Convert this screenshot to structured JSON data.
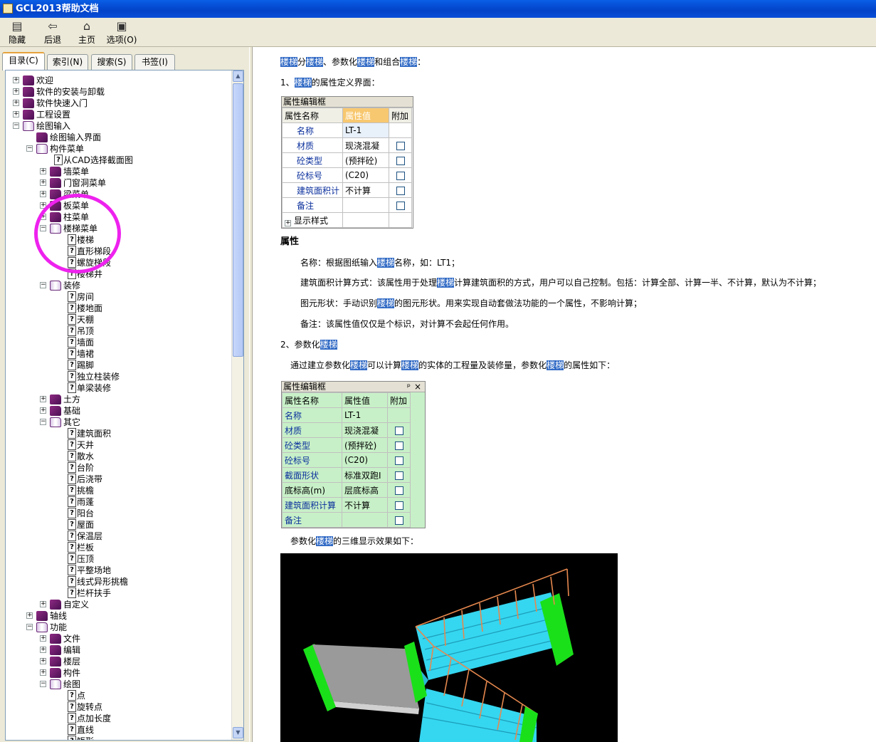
{
  "window": {
    "title": "GCL2013帮助文档"
  },
  "toolbar": {
    "hide": "隐藏",
    "back": "后退",
    "home": "主页",
    "options": "选项(O)"
  },
  "tabs": [
    "目录(C)",
    "索引(N)",
    "搜索(S)",
    "书签(I)"
  ],
  "tree": [
    {
      "label": "欢迎",
      "type": "book",
      "level": 0,
      "expanded": false
    },
    {
      "label": "软件的安装与卸载",
      "type": "book",
      "level": 0,
      "expanded": false
    },
    {
      "label": "软件快速入门",
      "type": "book",
      "level": 0,
      "expanded": false
    },
    {
      "label": "工程设置",
      "type": "book",
      "level": 0,
      "expanded": false
    },
    {
      "label": "绘图输入",
      "type": "book",
      "level": 0,
      "expanded": true
    },
    {
      "label": "绘图输入界面",
      "type": "book",
      "level": 1,
      "expanded": false,
      "noexp": true
    },
    {
      "label": "构件菜单",
      "type": "book",
      "level": 1,
      "expanded": true
    },
    {
      "label": "从CAD选择截面图",
      "type": "page",
      "level": 2
    },
    {
      "label": "墙菜单",
      "type": "book",
      "level": 2,
      "expanded": false
    },
    {
      "label": "门窗洞菜单",
      "type": "book",
      "level": 2,
      "expanded": false
    },
    {
      "label": "梁菜单",
      "type": "book",
      "level": 2,
      "expanded": false
    },
    {
      "label": "板菜单",
      "type": "book",
      "level": 2,
      "expanded": false
    },
    {
      "label": "柱菜单",
      "type": "book",
      "level": 2,
      "expanded": false
    },
    {
      "label": "楼梯菜单",
      "type": "book",
      "level": 2,
      "expanded": true
    },
    {
      "label": "楼梯",
      "type": "page",
      "level": 3
    },
    {
      "label": "直形梯段",
      "type": "page",
      "level": 3
    },
    {
      "label": "螺旋梯段",
      "type": "page",
      "level": 3
    },
    {
      "label": "楼梯井",
      "type": "page",
      "level": 3
    },
    {
      "label": "装修",
      "type": "book",
      "level": 2,
      "expanded": true
    },
    {
      "label": "房间",
      "type": "page",
      "level": 3
    },
    {
      "label": "楼地面",
      "type": "page",
      "level": 3
    },
    {
      "label": "天棚",
      "type": "page",
      "level": 3
    },
    {
      "label": "吊顶",
      "type": "page",
      "level": 3
    },
    {
      "label": "墙面",
      "type": "page",
      "level": 3
    },
    {
      "label": "墙裙",
      "type": "page",
      "level": 3
    },
    {
      "label": "踢脚",
      "type": "page",
      "level": 3
    },
    {
      "label": "独立柱装修",
      "type": "page",
      "level": 3
    },
    {
      "label": "单梁装修",
      "type": "page",
      "level": 3
    },
    {
      "label": "土方",
      "type": "book",
      "level": 2,
      "expanded": false
    },
    {
      "label": "基础",
      "type": "book",
      "level": 2,
      "expanded": false
    },
    {
      "label": "其它",
      "type": "book",
      "level": 2,
      "expanded": true
    },
    {
      "label": "建筑面积",
      "type": "page",
      "level": 3
    },
    {
      "label": "天井",
      "type": "page",
      "level": 3
    },
    {
      "label": "散水",
      "type": "page",
      "level": 3
    },
    {
      "label": "台阶",
      "type": "page",
      "level": 3
    },
    {
      "label": "后浇带",
      "type": "page",
      "level": 3
    },
    {
      "label": "挑檐",
      "type": "page",
      "level": 3
    },
    {
      "label": "雨蓬",
      "type": "page",
      "level": 3
    },
    {
      "label": "阳台",
      "type": "page",
      "level": 3
    },
    {
      "label": "屋面",
      "type": "page",
      "level": 3
    },
    {
      "label": "保温层",
      "type": "page",
      "level": 3
    },
    {
      "label": "栏板",
      "type": "page",
      "level": 3
    },
    {
      "label": "压顶",
      "type": "page",
      "level": 3
    },
    {
      "label": "平整场地",
      "type": "page",
      "level": 3
    },
    {
      "label": "线式异形挑檐",
      "type": "page",
      "level": 3
    },
    {
      "label": "栏杆扶手",
      "type": "page",
      "level": 3
    },
    {
      "label": "自定义",
      "type": "book",
      "level": 2,
      "expanded": false
    },
    {
      "label": "轴线",
      "type": "book",
      "level": 1,
      "expanded": false
    },
    {
      "label": "功能",
      "type": "book",
      "level": 1,
      "expanded": true
    },
    {
      "label": "文件",
      "type": "book",
      "level": 2,
      "expanded": false
    },
    {
      "label": "编辑",
      "type": "book",
      "level": 2,
      "expanded": false
    },
    {
      "label": "楼层",
      "type": "book",
      "level": 2,
      "expanded": false
    },
    {
      "label": "构件",
      "type": "book",
      "level": 2,
      "expanded": false
    },
    {
      "label": "绘图",
      "type": "book",
      "level": 2,
      "expanded": true
    },
    {
      "label": "点",
      "type": "page",
      "level": 3
    },
    {
      "label": "旋转点",
      "type": "page",
      "level": 3
    },
    {
      "label": "点加长度",
      "type": "page",
      "level": 3
    },
    {
      "label": "直线",
      "type": "page",
      "level": 3
    },
    {
      "label": "矩形",
      "type": "page",
      "level": 3
    }
  ],
  "content": {
    "intro": [
      "楼梯",
      "分",
      "楼梯",
      "、参数化",
      "楼梯",
      "和组合",
      "楼梯",
      "："
    ],
    "s1": [
      "1、",
      "楼梯",
      "的属性定义界面："
    ],
    "grid1": {
      "caption": "属性编辑框",
      "headers": [
        "属性名称",
        "属性值",
        "附加"
      ],
      "rows": [
        {
          "name": "名称",
          "value": "LT-1",
          "check": false
        },
        {
          "name": "材质",
          "value": "现浇混凝",
          "check": true
        },
        {
          "name": "砼类型",
          "value": "(预拌砼)",
          "check": true
        },
        {
          "name": "砼标号",
          "value": "(C20)",
          "check": true
        },
        {
          "name": "建筑面积计",
          "value": "不计算",
          "check": true
        },
        {
          "name": "备注",
          "value": "",
          "check": true
        }
      ],
      "footer": "显示样式"
    },
    "heading": "属性",
    "p_name": [
      "名称：根据图纸输入",
      "楼梯",
      "名称，如：LT1；"
    ],
    "p_area": [
      "建筑面积计算方式：该属性用于处理",
      "楼梯",
      "计算建筑面积的方式，用户可以自己控制。包括：计算全部、计算一半、不计算，默认为不计算；"
    ],
    "p_shape": [
      "图元形状：手动识别",
      "楼梯",
      "的图元形状。用来实现自动套做法功能的一个属性，不影响计算；"
    ],
    "p_note": "备注：该属性值仅仅是个标识，对计算不会起任何作用。",
    "s2": [
      "2、参数化",
      "楼梯"
    ],
    "p_param": [
      "通过建立参数化",
      "楼梯",
      "可以计算",
      "楼梯",
      "的实体的工程量及装修量，参数化",
      "楼梯",
      "的属性如下："
    ],
    "grid2": {
      "caption": "属性编辑框",
      "pin": "ᵖ",
      "close": "×",
      "headers": [
        "属性名称",
        "属性值",
        "附加"
      ],
      "rows": [
        {
          "name": "名称",
          "value": "LT-1",
          "check": false,
          "blue": true
        },
        {
          "name": "材质",
          "value": "现浇混凝",
          "check": true,
          "blue": true
        },
        {
          "name": "砼类型",
          "value": "(预拌砼)",
          "check": true,
          "blue": true
        },
        {
          "name": "砼标号",
          "value": "(C20)",
          "check": true,
          "blue": true
        },
        {
          "name": "截面形状",
          "value": "标准双跑I",
          "check": true,
          "blue": true
        },
        {
          "name": "底标高(m)",
          "value": "层底标高",
          "check": true,
          "blue": false
        },
        {
          "name": "建筑面积计算",
          "value": "不计算",
          "check": true,
          "blue": true
        },
        {
          "name": "备注",
          "value": "",
          "check": true,
          "blue": true
        }
      ]
    },
    "p_3d": [
      "参数化",
      "楼梯",
      "的三维显示效果如下："
    ]
  },
  "colors": {
    "highlight": "#316ac5",
    "annotation_circle": "#ee22ee",
    "grid2_bg": "#c8f0c8"
  }
}
